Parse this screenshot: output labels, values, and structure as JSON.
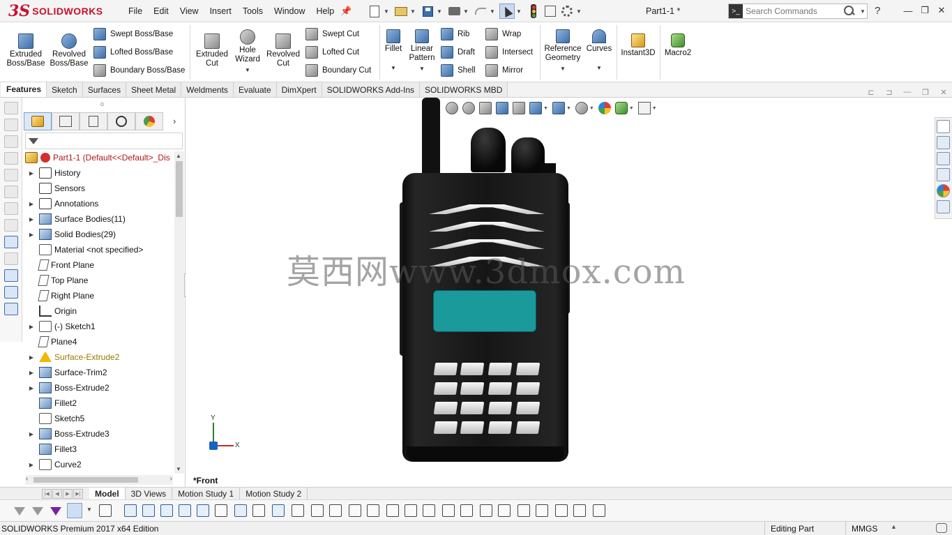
{
  "app": {
    "logo_ds": "3S",
    "logo_name": "SOLIDWORKS",
    "menu": [
      "File",
      "Edit",
      "View",
      "Insert",
      "Tools",
      "Window",
      "Help"
    ],
    "document_title": "Part1-1 *",
    "search_placeholder": "Search Commands",
    "help_label": "?",
    "window_controls": [
      "—",
      "❐",
      "✕"
    ]
  },
  "ribbon": {
    "extruded_boss": "Extruded Boss/Base",
    "revolved_boss": "Revolved Boss/Base",
    "swept_boss": "Swept Boss/Base",
    "lofted_boss": "Lofted Boss/Base",
    "boundary_boss": "Boundary Boss/Base",
    "extruded_cut": "Extruded Cut",
    "hole_wizard": "Hole Wizard",
    "revolved_cut": "Revolved Cut",
    "swept_cut": "Swept Cut",
    "lofted_cut": "Lofted Cut",
    "boundary_cut": "Boundary Cut",
    "fillet": "Fillet",
    "linear_pattern": "Linear Pattern",
    "rib": "Rib",
    "draft": "Draft",
    "shell": "Shell",
    "wrap": "Wrap",
    "intersect": "Intersect",
    "mirror": "Mirror",
    "reference_geometry": "Reference Geometry",
    "curves": "Curves",
    "instant3d": "Instant3D",
    "macro": "Macro2"
  },
  "command_tabs": [
    "Features",
    "Sketch",
    "Surfaces",
    "Sheet Metal",
    "Weldments",
    "Evaluate",
    "DimXpert",
    "SOLIDWORKS Add-Ins",
    "SOLIDWORKS MBD"
  ],
  "feature_tree": {
    "part": "Part1-1  (Default<<Default>_Dis",
    "items": [
      {
        "label": "History",
        "expandable": true,
        "icon": "folder-icon"
      },
      {
        "label": "Sensors",
        "expandable": false,
        "icon": "sensor-icon"
      },
      {
        "label": "Annotations",
        "expandable": true,
        "icon": "annotation-icon"
      },
      {
        "label": "Surface Bodies(11)",
        "expandable": true,
        "icon": "surface-bodies-icon"
      },
      {
        "label": "Solid Bodies(29)",
        "expandable": true,
        "icon": "solid-bodies-icon"
      },
      {
        "label": "Material <not specified>",
        "expandable": false,
        "icon": "material-icon"
      },
      {
        "label": "Front Plane",
        "expandable": false,
        "icon": "plane-icon"
      },
      {
        "label": "Top Plane",
        "expandable": false,
        "icon": "plane-icon"
      },
      {
        "label": "Right Plane",
        "expandable": false,
        "icon": "plane-icon"
      },
      {
        "label": "Origin",
        "expandable": false,
        "icon": "origin-icon"
      },
      {
        "label": "(-) Sketch1",
        "expandable": true,
        "icon": "sketch-icon"
      },
      {
        "label": "Plane4",
        "expandable": false,
        "icon": "plane-icon"
      },
      {
        "label": "Surface-Extrude2",
        "expandable": true,
        "icon": "warning-icon",
        "warning": true
      },
      {
        "label": "Surface-Trim2",
        "expandable": true,
        "icon": "surface-trim-icon"
      },
      {
        "label": "Boss-Extrude2",
        "expandable": true,
        "icon": "boss-extrude-icon"
      },
      {
        "label": "Fillet2",
        "expandable": false,
        "icon": "fillet-icon"
      },
      {
        "label": "Sketch5",
        "expandable": false,
        "icon": "sketch-icon"
      },
      {
        "label": "Boss-Extrude3",
        "expandable": true,
        "icon": "boss-extrude-icon"
      },
      {
        "label": "Fillet3",
        "expandable": false,
        "icon": "fillet-icon"
      },
      {
        "label": "Curve2",
        "expandable": true,
        "icon": "curve-icon"
      }
    ]
  },
  "graphics": {
    "view_label": "*Front",
    "watermark": "莫西网www.3dmox.com",
    "triad_x": "X",
    "triad_y": "Y",
    "screen_color": "#1a9a9b"
  },
  "model_tabs": [
    "Model",
    "3D Views",
    "Motion Study 1",
    "Motion Study 2"
  ],
  "status": {
    "edition": "SOLIDWORKS Premium 2017 x64 Edition",
    "mode": "Editing Part",
    "units": "MMGS"
  }
}
